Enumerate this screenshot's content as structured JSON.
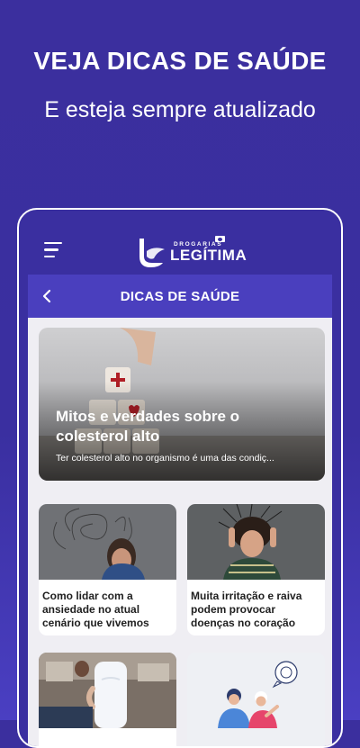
{
  "promo": {
    "title": "VEJA DICAS DE SAÚDE",
    "subtitle": "E esteja sempre atualizado"
  },
  "app": {
    "logo_small": "DROGARIAS",
    "logo_name": "LEGÍTIMA",
    "page_title": "DICAS DE SAÚDE"
  },
  "featured": {
    "title": "Mitos e verdades sobre o colesterol alto",
    "excerpt": "Ter colesterol alto no organismo é uma das condiç..."
  },
  "articles": [
    {
      "title": "Como lidar com a ansiedade no atual cenário que vivemos",
      "image": "stressed-woman-photo"
    },
    {
      "title": "Muita irritação e raiva podem provocar doenças no coração",
      "image": "angry-woman-photo"
    },
    {
      "title": "",
      "image": "back-pain-photo"
    },
    {
      "title": "",
      "image": "doctor-patient-illustration"
    }
  ],
  "colors": {
    "background": "#3a2fa0",
    "titlebar": "#4a3fbe",
    "screen": "#efeef3"
  }
}
